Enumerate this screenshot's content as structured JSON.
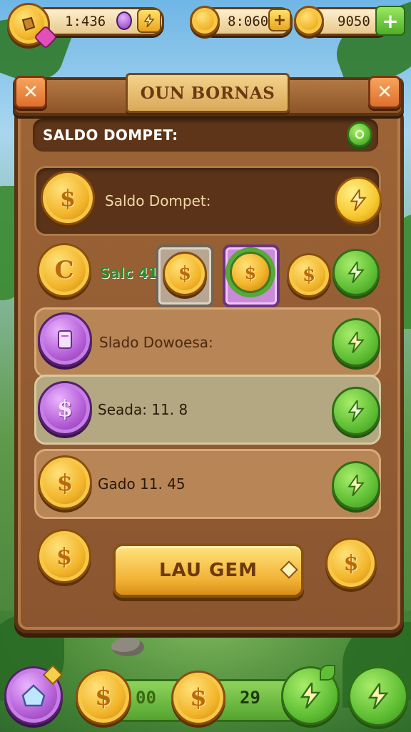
{
  "hud": {
    "left_value": "1:436",
    "center_value": "8:060",
    "right_value": "9050",
    "plus_glyph": "+"
  },
  "panel": {
    "title": "OUN BORNAS",
    "close_glyph": "✕",
    "wallet_label": "SALDO DOMPET:"
  },
  "rows": [
    {
      "label": "Saldo Dompet:"
    },
    {
      "label": "Salc 41"
    },
    {
      "label": "Slado Dowoesa:"
    },
    {
      "label": "Seada: 11. 8"
    },
    {
      "label": "Gado 11. 45"
    }
  ],
  "cta": {
    "label": "LAU GEM"
  },
  "bottom": {
    "left_value": "00",
    "right_value": "29"
  },
  "coin_glyphs": {
    "dollar": "$",
    "c": "C"
  },
  "icons": {
    "badge": "lightning-bolt-icon",
    "gem": "purple-gem-icon",
    "card": "card-icon",
    "house": "house-icon"
  },
  "colors": {
    "wood": "#8a5530",
    "gold": "#f2b52a",
    "green": "#5fbf34",
    "purple": "#b45ed6"
  }
}
